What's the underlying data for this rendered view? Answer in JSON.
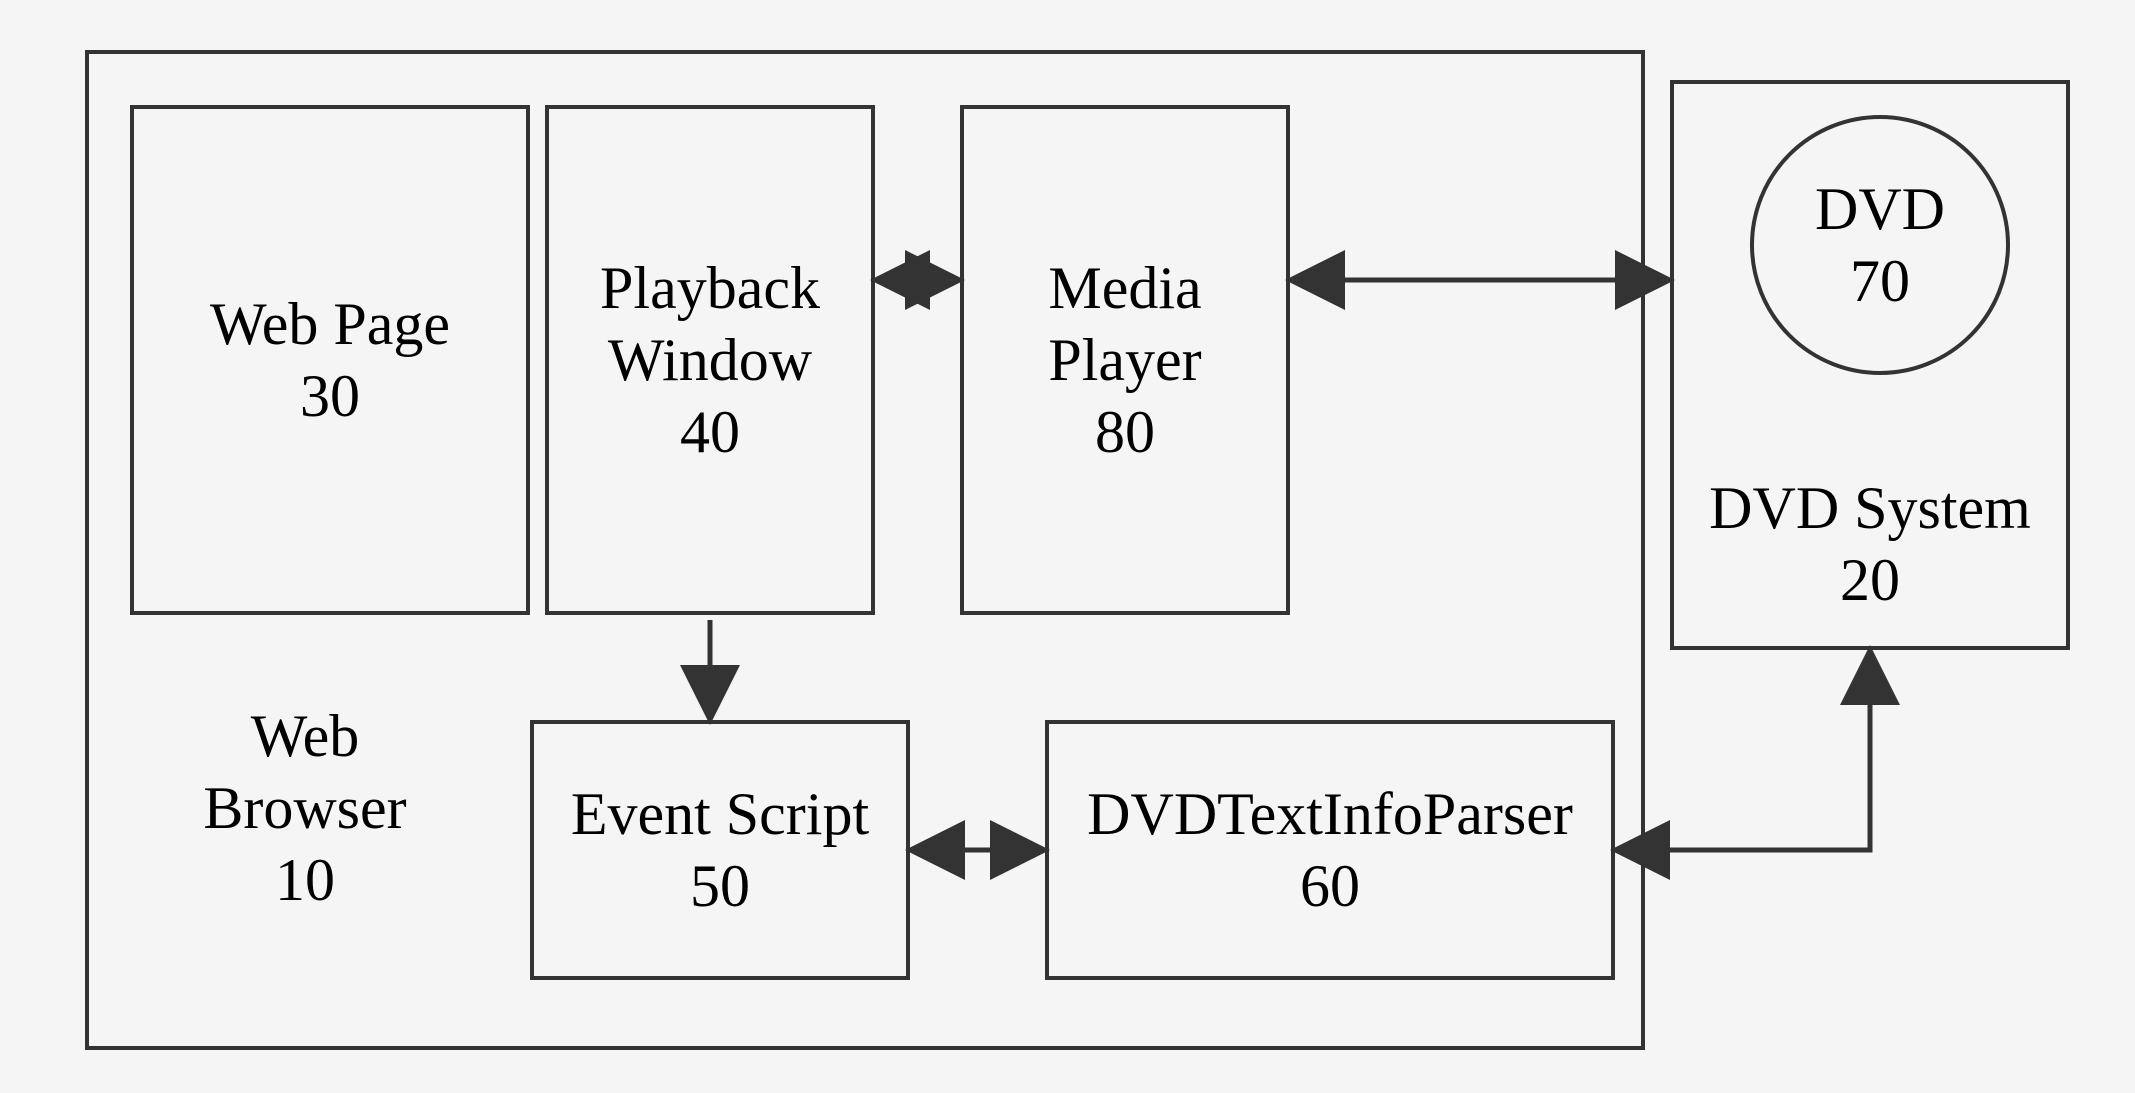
{
  "diagram": {
    "webBrowser": {
      "label": "Web",
      "label2": "Browser",
      "num": "10"
    },
    "webPage": {
      "label": "Web Page",
      "num": "30"
    },
    "playbackWindow": {
      "label": "Playback",
      "label2": "Window",
      "num": "40"
    },
    "eventScript": {
      "label": "Event Script",
      "num": "50"
    },
    "mediaPlayer": {
      "label": "Media",
      "label2": "Player",
      "num": "80"
    },
    "dvdTextInfoParser": {
      "label": "DVDTextInfoParser",
      "num": "60"
    },
    "dvdSystem": {
      "label": "DVD System",
      "num": "20"
    },
    "dvd": {
      "label": "DVD",
      "num": "70"
    }
  }
}
